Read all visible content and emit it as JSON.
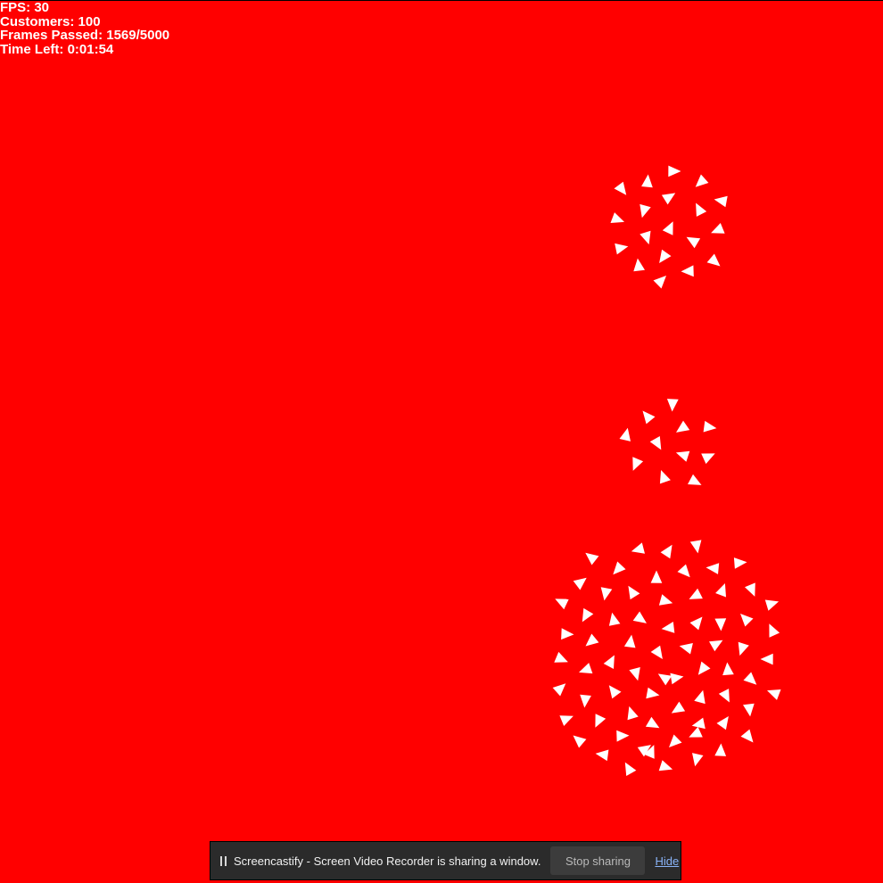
{
  "hud": {
    "fps": "FPS: 30",
    "customers": "Customers: 100",
    "frames": "Frames Passed: 1569/5000",
    "time_left": "Time Left: 0:01:54"
  },
  "colors": {
    "background": "#ff0000",
    "agent": "#ffffff",
    "bar": "#2b2b2b",
    "link": "#8ab4f8"
  },
  "share_bar": {
    "pause_icon": "pause-icon",
    "message": "Screencastify - Screen Video Recorder is sharing a window.",
    "stop_label": "Stop sharing",
    "hide_label": "Hide"
  }
}
